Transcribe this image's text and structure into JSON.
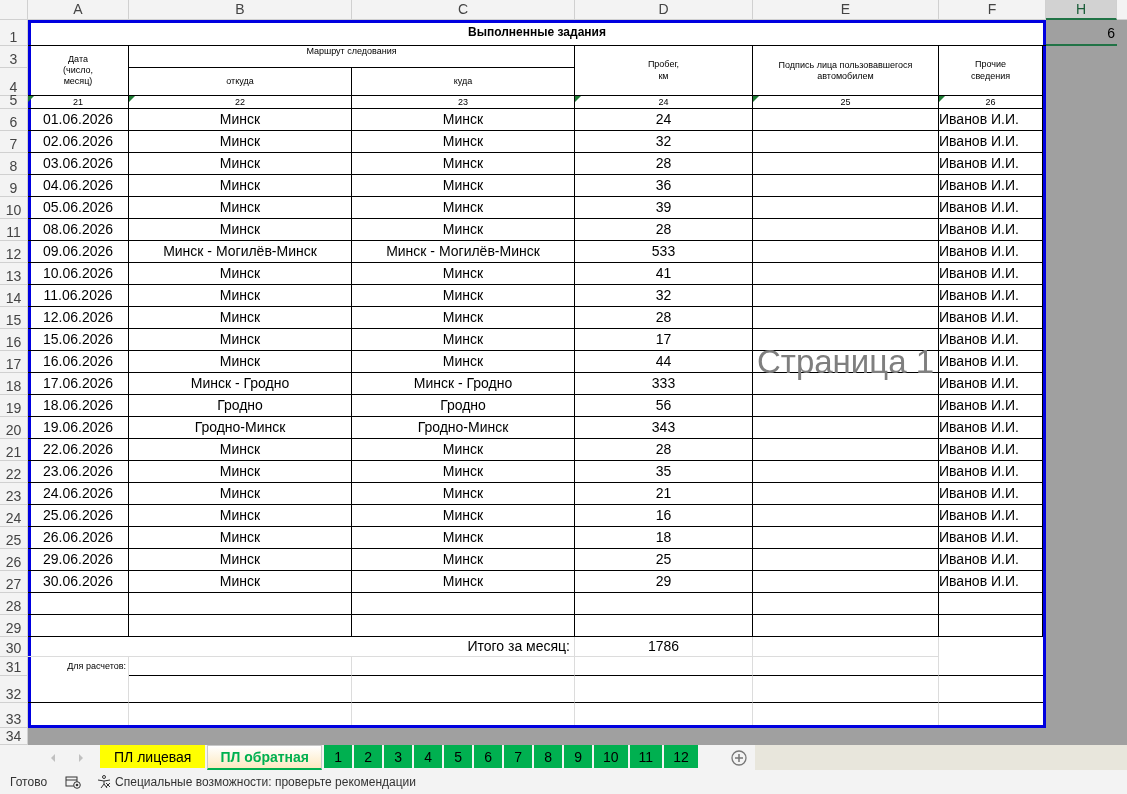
{
  "column_headers": [
    {
      "label": "A",
      "selected": false
    },
    {
      "label": "B",
      "selected": false
    },
    {
      "label": "C",
      "selected": false
    },
    {
      "label": "D",
      "selected": false
    },
    {
      "label": "E",
      "selected": false
    },
    {
      "label": "F",
      "selected": false
    },
    {
      "label": "H",
      "selected": true
    }
  ],
  "row_headers": [
    "1",
    "3",
    "4",
    "5",
    "6",
    "7",
    "8",
    "9",
    "10",
    "11",
    "12",
    "13",
    "14",
    "15",
    "16",
    "17",
    "18",
    "19",
    "20",
    "21",
    "22",
    "23",
    "24",
    "25",
    "26",
    "27",
    "28",
    "29",
    "30",
    "31",
    "32",
    "33",
    "34"
  ],
  "title": "Выполненные задания",
  "header": {
    "date": "Дата\n(число,\nмесяц)",
    "route": "Маршрут следования",
    "from": "откуда",
    "to": "куда",
    "mileage": "Пробег,\nкм",
    "signature": "Подпись лица пользовавшегося\nавтомобилем",
    "other": "Прочие\nсведения"
  },
  "column_numbers": [
    {
      "text": "21",
      "flagged": true
    },
    {
      "text": "22",
      "flagged": true
    },
    {
      "text": "23",
      "flagged": false
    },
    {
      "text": "24",
      "flagged": true
    },
    {
      "text": "25",
      "flagged": true
    },
    {
      "text": "26",
      "flagged": true
    }
  ],
  "rows": [
    {
      "date": "01.06.2026",
      "from": "Минск",
      "to": "Минск",
      "km": "24",
      "other": "Иванов И.И."
    },
    {
      "date": "02.06.2026",
      "from": "Минск",
      "to": "Минск",
      "km": "32",
      "other": "Иванов И.И."
    },
    {
      "date": "03.06.2026",
      "from": "Минск",
      "to": "Минск",
      "km": "28",
      "other": "Иванов И.И."
    },
    {
      "date": "04.06.2026",
      "from": "Минск",
      "to": "Минск",
      "km": "36",
      "other": "Иванов И.И."
    },
    {
      "date": "05.06.2026",
      "from": "Минск",
      "to": "Минск",
      "km": "39",
      "other": "Иванов И.И."
    },
    {
      "date": "08.06.2026",
      "from": "Минск",
      "to": "Минск",
      "km": "28",
      "other": "Иванов И.И."
    },
    {
      "date": "09.06.2026",
      "from": "Минск - Могилёв-Минск",
      "to": "Минск - Могилёв-Минск",
      "km": "533",
      "other": "Иванов И.И."
    },
    {
      "date": "10.06.2026",
      "from": "Минск",
      "to": "Минск",
      "km": "41",
      "other": "Иванов И.И."
    },
    {
      "date": "11.06.2026",
      "from": "Минск",
      "to": "Минск",
      "km": "32",
      "other": "Иванов И.И."
    },
    {
      "date": "12.06.2026",
      "from": "Минск",
      "to": "Минск",
      "km": "28",
      "other": "Иванов И.И."
    },
    {
      "date": "15.06.2026",
      "from": "Минск",
      "to": "Минск",
      "km": "17",
      "other": "Иванов И.И."
    },
    {
      "date": "16.06.2026",
      "from": "Минск",
      "to": "Минск",
      "km": "44",
      "other": "Иванов И.И."
    },
    {
      "date": "17.06.2026",
      "from": "Минск - Гродно",
      "to": "Минск - Гродно",
      "km": "333",
      "other": "Иванов И.И."
    },
    {
      "date": "18.06.2026",
      "from": "Гродно",
      "to": "Гродно",
      "km": "56",
      "other": "Иванов И.И."
    },
    {
      "date": "19.06.2026",
      "from": "Гродно-Минск",
      "to": "Гродно-Минск",
      "km": "343",
      "other": "Иванов И.И."
    },
    {
      "date": "22.06.2026",
      "from": "Минск",
      "to": "Минск",
      "km": "28",
      "other": "Иванов И.И."
    },
    {
      "date": "23.06.2026",
      "from": "Минск",
      "to": "Минск",
      "km": "35",
      "other": "Иванов И.И."
    },
    {
      "date": "24.06.2026",
      "from": "Минск",
      "to": "Минск",
      "km": "21",
      "other": "Иванов И.И."
    },
    {
      "date": "25.06.2026",
      "from": "Минск",
      "to": "Минск",
      "km": "16",
      "other": "Иванов И.И."
    },
    {
      "date": "26.06.2026",
      "from": "Минск",
      "to": "Минск",
      "km": "18",
      "other": "Иванов И.И."
    },
    {
      "date": "29.06.2026",
      "from": "Минск",
      "to": "Минск",
      "km": "25",
      "other": "Иванов И.И."
    },
    {
      "date": "30.06.2026",
      "from": "Минск",
      "to": "Минск",
      "km": "29",
      "other": "Иванов И.И."
    }
  ],
  "total": {
    "label": "Итого за месяц:",
    "value": "1786"
  },
  "for_calc": "Для расчетов:",
  "h1": {
    "value": "6",
    "selected": true
  },
  "page_label": "Страница 1",
  "tabs": [
    {
      "label": "ПЛ лицевая",
      "color": "#ffff00",
      "selected": false
    },
    {
      "label": "ПЛ обратная",
      "color": "#00b050",
      "selected": true
    },
    {
      "label": "1",
      "color": "#00b050",
      "selected": false
    },
    {
      "label": "2",
      "color": "#00b050",
      "selected": false
    },
    {
      "label": "3",
      "color": "#00b050",
      "selected": false
    },
    {
      "label": "4",
      "color": "#00b050",
      "selected": false
    },
    {
      "label": "5",
      "color": "#00b050",
      "selected": false
    },
    {
      "label": "6",
      "color": "#00b050",
      "selected": false
    },
    {
      "label": "7",
      "color": "#00b050",
      "selected": false
    },
    {
      "label": "8",
      "color": "#00b050",
      "selected": false
    },
    {
      "label": "9",
      "color": "#00b050",
      "selected": false
    },
    {
      "label": "10",
      "color": "#00b050",
      "selected": false
    },
    {
      "label": "11",
      "color": "#00b050",
      "selected": false
    },
    {
      "label": "12",
      "color": "#00b050",
      "selected": false
    }
  ],
  "status": {
    "ready": "Готово",
    "accessibility": "Специальные возможности: проверьте рекомендации"
  }
}
